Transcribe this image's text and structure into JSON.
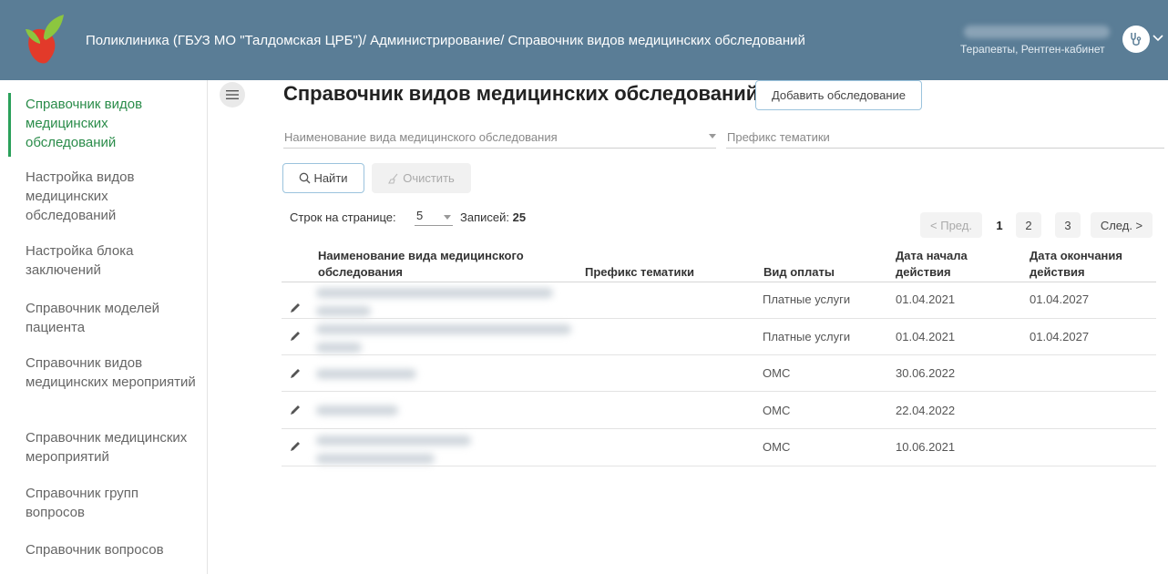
{
  "header": {
    "title": "Поликлиника (ГБУЗ МО \"Талдомская ЦРБ\")/ Администрирование/ Справочник видов медицинских обследований",
    "user_roles": "Терапевты, Рентген-кабинет",
    "logo_icon": "heart-leaf-logo",
    "avatar_icon": "stethoscope-icon",
    "colors": {
      "header_bg": "#5a7d96",
      "accent": "#2aa05a"
    }
  },
  "sidebar": {
    "items": [
      {
        "label": "Справочник видов медицинских обследований",
        "active": true
      },
      {
        "label": "Настройка видов медицинских обследований"
      },
      {
        "label": "Настройка блока заключений"
      },
      {
        "label": "Справочник моделей пациента"
      },
      {
        "label": "Справочник видов медицинских мероприятий"
      },
      {
        "label": "Справочник медицинских мероприятий"
      },
      {
        "label": "Справочник групп вопросов"
      },
      {
        "label": "Справочник вопросов"
      }
    ]
  },
  "main": {
    "title": "Справочник видов медицинских обследований",
    "add_button": "Добавить обследование",
    "filters": {
      "name_placeholder": "Наименование вида медицинского обследования",
      "prefix_placeholder": "Префикс тематики"
    },
    "find_button": "Найти",
    "clear_button": "Очистить",
    "rows_per_page_label": "Строк на странице:",
    "rows_per_page_value": "5",
    "records_label": "Записей:",
    "records_count": "25",
    "pager": {
      "prev": "< Пред.",
      "pages": [
        "1",
        "2",
        "3"
      ],
      "current": "1",
      "next": "След. >"
    }
  },
  "table": {
    "columns": [
      "Наименование вида медицинского обследования",
      "Префикс тематики",
      "Вид оплаты",
      "Дата начала действия",
      "Дата окончания действия"
    ],
    "rows": [
      {
        "payment": "Платные услуги",
        "start": "01.04.2021",
        "end": "01.04.2027"
      },
      {
        "payment": "Платные услуги",
        "start": "01.04.2021",
        "end": "01.04.2027"
      },
      {
        "payment": "ОМС",
        "start": "30.06.2022",
        "end": ""
      },
      {
        "payment": "ОМС",
        "start": "22.04.2022",
        "end": ""
      },
      {
        "payment": "ОМС",
        "start": "10.06.2021",
        "end": ""
      }
    ]
  }
}
